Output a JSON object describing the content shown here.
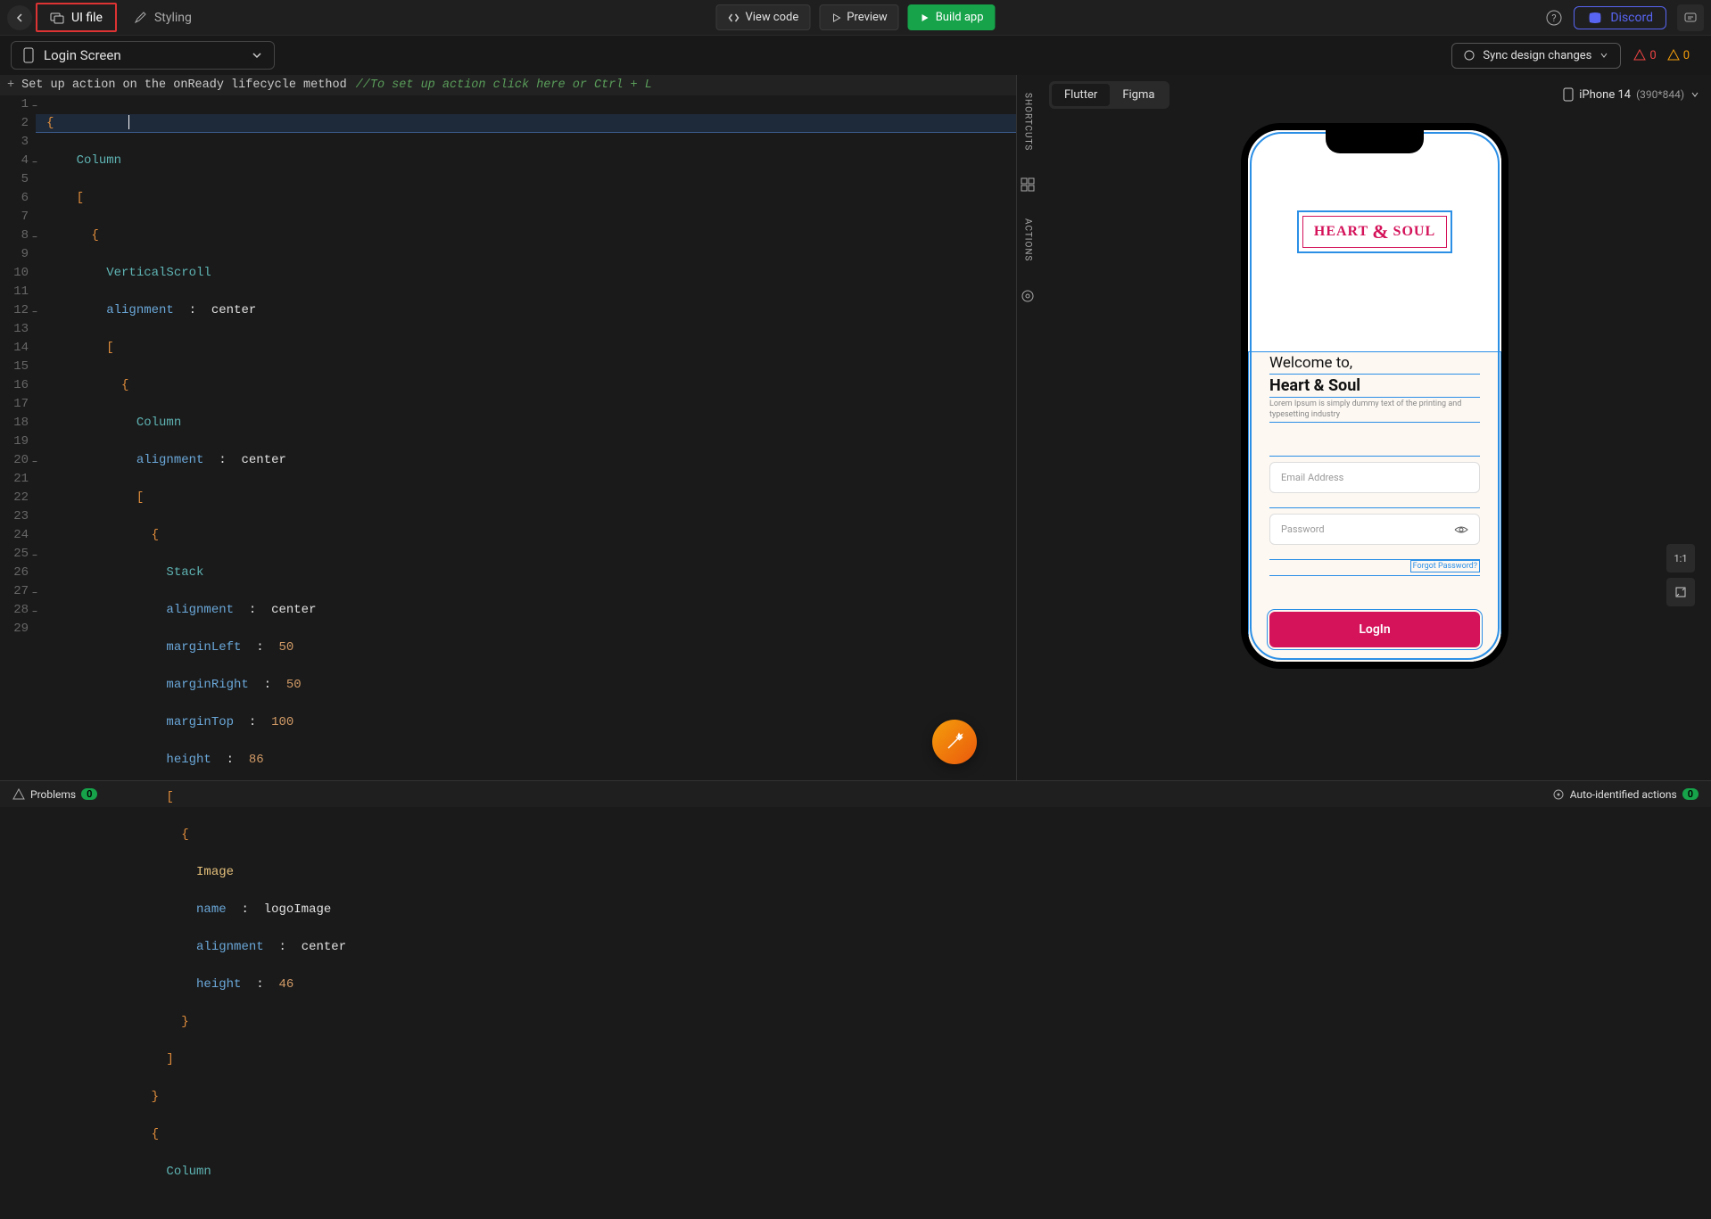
{
  "topbar": {
    "tabs": {
      "ui_file": "UI file",
      "styling": "Styling"
    },
    "buttons": {
      "view_code": "View code",
      "preview": "Preview",
      "build_app": "Build app",
      "discord": "Discord"
    }
  },
  "subheader": {
    "file_name": "Login Screen",
    "sync": "Sync design changes",
    "errors": "0",
    "warnings": "0"
  },
  "editor": {
    "action_label": "Set up action on the onReady lifecycle method",
    "action_hint": "//To set up action click here or Ctrl + L",
    "lines": {
      "l1": "{",
      "l2": "Column",
      "l3": "[",
      "l4": "{",
      "l5": "VerticalScroll",
      "l6a": "alignment",
      "l6b": ":",
      "l6c": "center",
      "l7": "[",
      "l8": "{",
      "l9": "Column",
      "l10a": "alignment",
      "l10b": ":",
      "l10c": "center",
      "l11": "[",
      "l12": "{",
      "l13": "Stack",
      "l14a": "alignment",
      "l14b": ":",
      "l14c": "center",
      "l15a": "marginLeft",
      "l15b": ":",
      "l15c": "50",
      "l16a": "marginRight",
      "l16b": ":",
      "l16c": "50",
      "l17a": "marginTop",
      "l17b": ":",
      "l17c": "100",
      "l18a": "height",
      "l18b": ":",
      "l18c": "86",
      "l19": "[",
      "l20": "{",
      "l21": "Image",
      "l22a": "name",
      "l22b": ":",
      "l22c": "logoImage",
      "l23a": "alignment",
      "l23b": ":",
      "l23c": "center",
      "l24a": "height",
      "l24b": ":",
      "l24c": "46",
      "l25": "}",
      "l26": "]",
      "l27": "}",
      "l28": "{",
      "l29": "Column"
    }
  },
  "rails": {
    "shortcuts": "SHORTCUTS",
    "actions": "ACTIONS"
  },
  "preview": {
    "tabs": {
      "flutter": "Flutter",
      "figma": "Figma"
    },
    "device": "iPhone 14",
    "dimensions": "(390*844)",
    "zoom": "1:1"
  },
  "phone": {
    "logo_heart": "HEART",
    "logo_amp": "&",
    "logo_soul": "SOUL",
    "welcome": "Welcome to,",
    "brand": "Heart & Soul",
    "lorem": "Lorem Ipsum is simply dummy text of the printing and typesetting industry",
    "email_placeholder": "Email Address",
    "password_placeholder": "Password",
    "forgot": "Forgot Password?",
    "login": "LogIn"
  },
  "bottombar": {
    "problems": "Problems",
    "problems_count": "0",
    "auto_actions": "Auto-identified actions",
    "auto_count": "0"
  }
}
